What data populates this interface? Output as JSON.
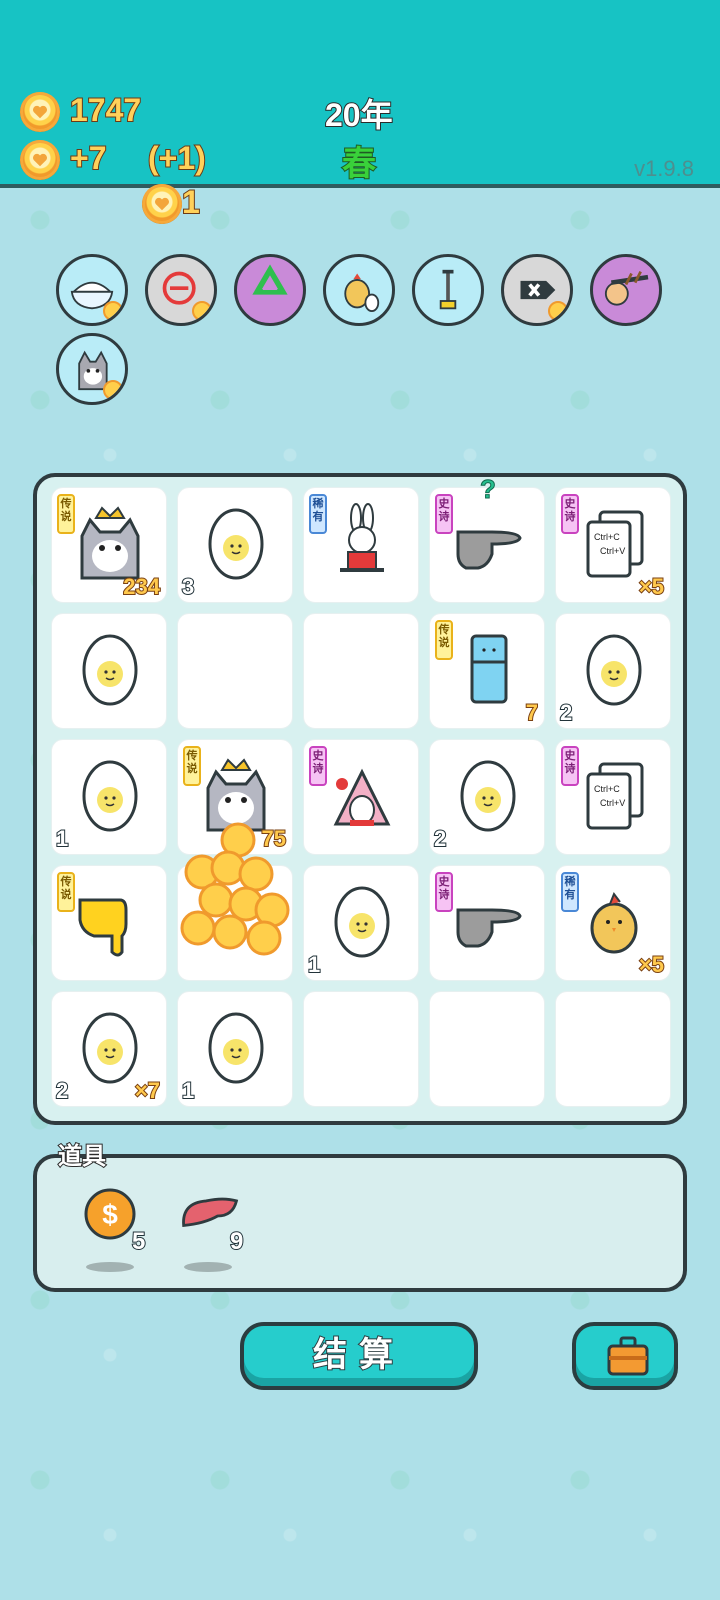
{
  "hud": {
    "coins": "1747",
    "income": "+7",
    "bonus": "(+1)",
    "extra": "1",
    "year": "20年",
    "season": "春",
    "version": "v1.9.8"
  },
  "skills": [
    {
      "name": "rice-bowl-icon"
    },
    {
      "name": "remove-icon"
    },
    {
      "name": "recycle-icon"
    },
    {
      "name": "chick-egg-icon"
    },
    {
      "name": "pump-icon"
    },
    {
      "name": "delete-tag-icon"
    },
    {
      "name": "slingshot-icon"
    },
    {
      "name": "husky-icon"
    }
  ],
  "board": {
    "cells": [
      {
        "item": "husky-king",
        "tag": "传说",
        "tag_type": "legend",
        "right": "234"
      },
      {
        "item": "egg",
        "left": "3"
      },
      {
        "item": "rabbit",
        "tag": "稀有",
        "tag_type": "rare"
      },
      {
        "item": "pointing-hand",
        "tag": "史诗",
        "tag_type": "epic",
        "question": "?"
      },
      {
        "item": "copy-paste",
        "tag": "史诗",
        "tag_type": "epic",
        "right": "×5"
      },
      {
        "item": "egg"
      },
      {
        "item": "empty"
      },
      {
        "item": "empty"
      },
      {
        "item": "fridge",
        "tag": "传说",
        "tag_type": "legend",
        "right": "7"
      },
      {
        "item": "egg",
        "left": "2"
      },
      {
        "item": "egg",
        "left": "1"
      },
      {
        "item": "husky-king",
        "tag": "传说",
        "tag_type": "legend",
        "right": "75"
      },
      {
        "item": "rabbit-house",
        "tag": "史诗",
        "tag_type": "epic"
      },
      {
        "item": "egg",
        "left": "2"
      },
      {
        "item": "copy-paste",
        "tag": "史诗",
        "tag_type": "epic"
      },
      {
        "item": "yellow-hand",
        "tag": "传说",
        "tag_type": "legend"
      },
      {
        "item": "empty"
      },
      {
        "item": "egg",
        "left": "1"
      },
      {
        "item": "pointing-hand",
        "tag": "史诗",
        "tag_type": "epic"
      },
      {
        "item": "chick",
        "tag": "稀有",
        "tag_type": "rare",
        "right": "×5"
      },
      {
        "item": "egg",
        "left": "2",
        "right": "×7"
      },
      {
        "item": "egg",
        "left": "1"
      },
      {
        "item": "empty"
      },
      {
        "item": "empty"
      },
      {
        "item": "empty"
      }
    ]
  },
  "tools": {
    "label": "道具",
    "items": [
      {
        "name": "dollar-coin-icon",
        "count": "5"
      },
      {
        "name": "liver-icon",
        "count": "9"
      }
    ]
  },
  "buttons": {
    "settle": "结算",
    "bag": "briefcase-icon"
  },
  "colors": {
    "topbar": "#17c3c4",
    "background": "#aee0e8",
    "button": "#26cdcc",
    "coin": "#ffd15a"
  }
}
